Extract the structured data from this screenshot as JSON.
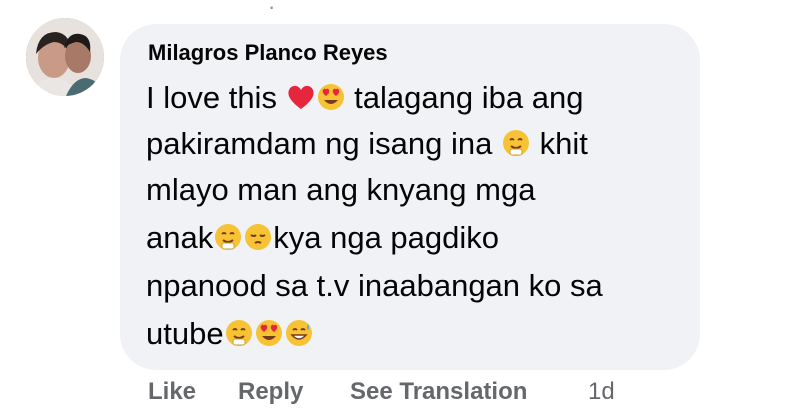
{
  "comment": {
    "author": "Milagros Planco Reyes",
    "lines": [
      {
        "segments": [
          "I love this ",
          "",
          "",
          "  talagang iba ang"
        ]
      },
      {
        "segments": [
          "pakiramdam ng isang ina ",
          "",
          " khit"
        ]
      },
      {
        "segments": [
          "mlayo man ang knyang mga"
        ]
      },
      {
        "segments": [
          "anak",
          "",
          "",
          "kya nga pagdiko"
        ]
      },
      {
        "segments": [
          "npanood sa t.v inaabangan ko sa"
        ]
      },
      {
        "segments": [
          "utube",
          "",
          "",
          ""
        ]
      }
    ],
    "emoji_names": [
      "red-heart-emoji",
      "heart-eyes-emoji",
      "smiling-hearts-emoji",
      "pensive-emoji",
      "grinning-sweat-emoji"
    ]
  },
  "actions": {
    "like": "Like",
    "reply": "Reply",
    "see_translation": "See Translation",
    "time": "1d"
  },
  "colors": {
    "bubble": "#f0f2f5",
    "text": "#050505",
    "meta": "#65676b"
  }
}
